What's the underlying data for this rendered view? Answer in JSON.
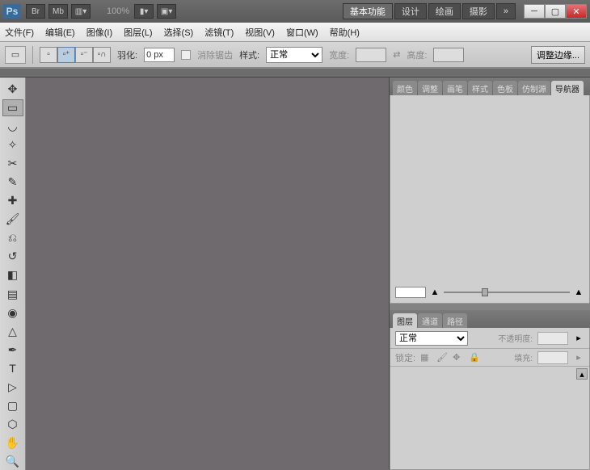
{
  "titlebar": {
    "logo": "Ps",
    "br": "Br",
    "mb": "Mb",
    "zoom": "100%",
    "workspaces": [
      "基本功能",
      "设计",
      "绘画",
      "摄影"
    ],
    "active_ws": 0,
    "more": "»"
  },
  "menu": {
    "file": "文件(F)",
    "edit": "编辑(E)",
    "image": "图像(I)",
    "layer": "图层(L)",
    "select": "选择(S)",
    "filter": "滤镜(T)",
    "view": "视图(V)",
    "window": "窗口(W)",
    "help": "帮助(H)"
  },
  "optbar": {
    "feather_label": "羽化:",
    "feather_value": "0 px",
    "antialias": "消除锯齿",
    "style_label": "样式:",
    "style_value": "正常",
    "width_label": "宽度:",
    "height_label": "高度:",
    "refine": "调整边缘..."
  },
  "panels": {
    "top_tabs": [
      "颜色",
      "调整",
      "画笔",
      "样式",
      "色板",
      "仿制源",
      "导航器"
    ],
    "top_active": 6,
    "nav_pct": "",
    "layer_tabs": [
      "图层",
      "通道",
      "路径"
    ],
    "layer_active": 0,
    "blend_mode": "正常",
    "opacity_label": "不透明度:",
    "lock_label": "锁定:",
    "fill_label": "填充:"
  },
  "tools": [
    "move",
    "marquee",
    "lasso",
    "wand",
    "crop",
    "eyedropper",
    "heal",
    "brush",
    "stamp",
    "history",
    "eraser",
    "gradient",
    "blur",
    "dodge",
    "pen",
    "type",
    "path-sel",
    "rect",
    "shape",
    "hand",
    "zoom"
  ]
}
